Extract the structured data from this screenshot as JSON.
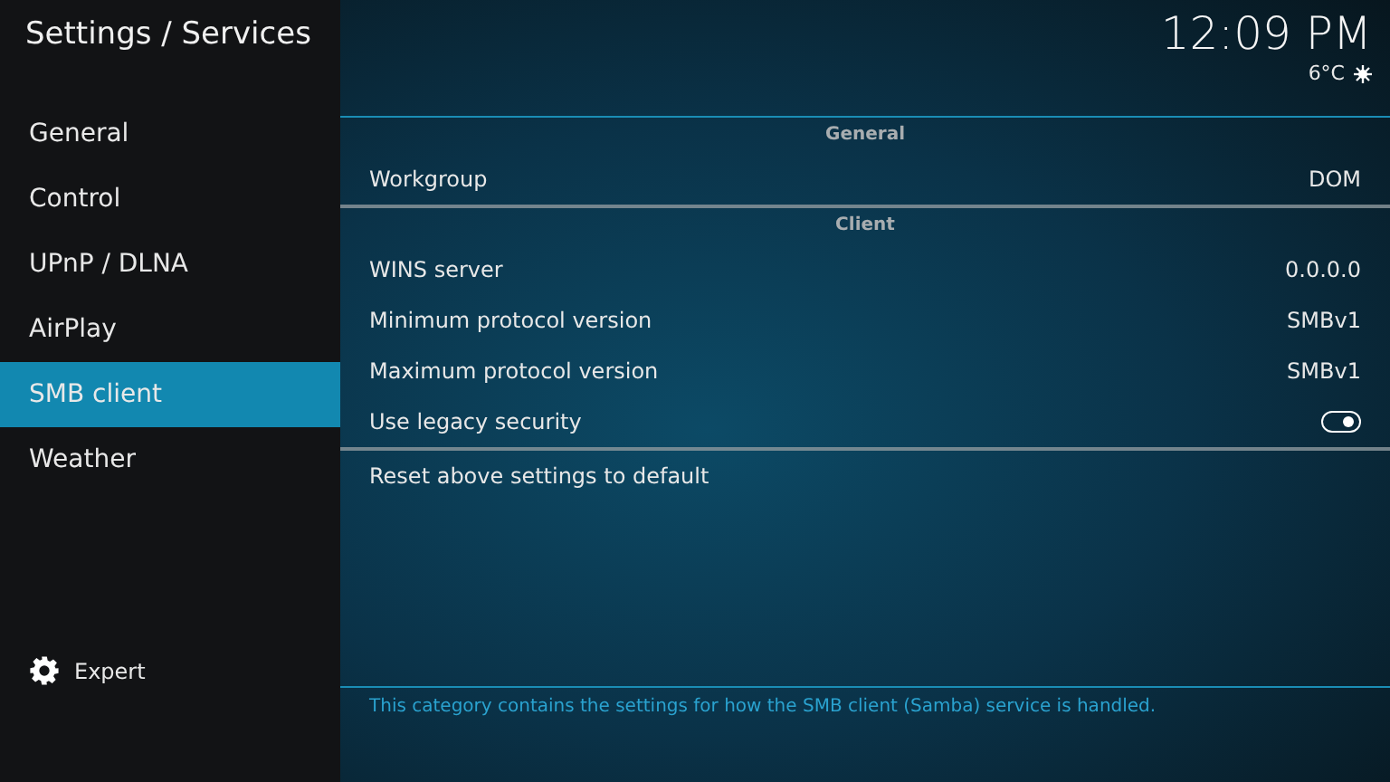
{
  "header": {
    "title": "Settings / Services",
    "time": "12:09 PM",
    "temperature": "6°C"
  },
  "sidebar": {
    "items": [
      {
        "label": "General",
        "selected": false
      },
      {
        "label": "Control",
        "selected": false
      },
      {
        "label": "UPnP / DLNA",
        "selected": false
      },
      {
        "label": "AirPlay",
        "selected": false
      },
      {
        "label": "SMB client",
        "selected": true
      },
      {
        "label": "Weather",
        "selected": false
      }
    ],
    "level_button": {
      "label": "Expert"
    }
  },
  "sections": [
    {
      "title": "General",
      "rows": [
        {
          "kind": "value",
          "label": "Workgroup",
          "value": "DOM"
        }
      ]
    },
    {
      "title": "Client",
      "rows": [
        {
          "kind": "value",
          "label": "WINS server",
          "value": "0.0.0.0"
        },
        {
          "kind": "value",
          "label": "Minimum protocol version",
          "value": "SMBv1"
        },
        {
          "kind": "value",
          "label": "Maximum protocol version",
          "value": "SMBv1"
        },
        {
          "kind": "toggle",
          "label": "Use legacy security",
          "on": true
        }
      ]
    }
  ],
  "reset": {
    "label": "Reset above settings to default"
  },
  "description": "This category contains the settings for how the SMB client (Samba) service is handled."
}
